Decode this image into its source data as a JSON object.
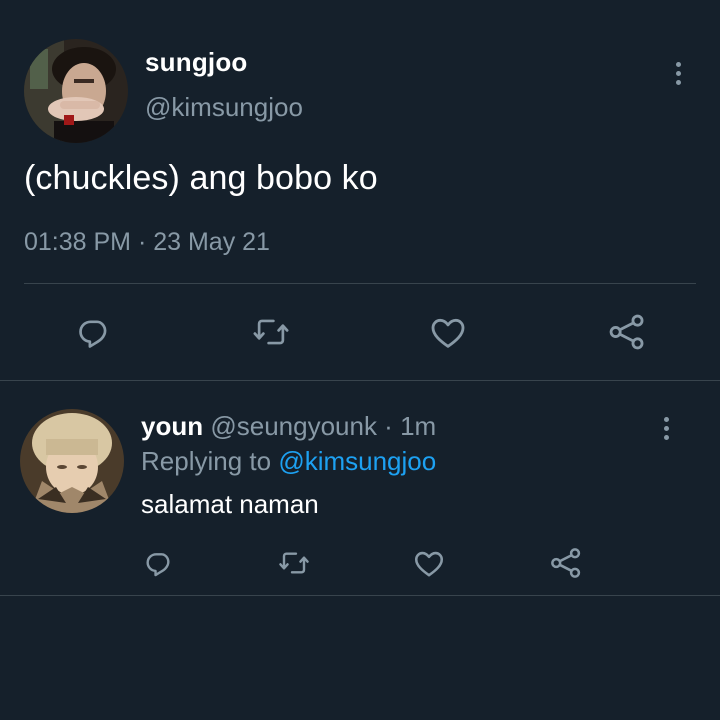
{
  "colors": {
    "background": "#15202b",
    "text_primary": "#ffffff",
    "text_secondary": "#8899a6",
    "divider": "#38444d",
    "link": "#1da1f2"
  },
  "main_tweet": {
    "display_name": "sungjoo",
    "handle": "@kimsungjoo",
    "text": "(chuckles) ang bobo ko",
    "timestamp": "01:38 PM · 23 May 21",
    "icons": [
      "more-vertical-icon",
      "reply-icon",
      "retweet-icon",
      "like-icon",
      "share-icon"
    ]
  },
  "reply_tweet": {
    "display_name": "youn",
    "meta": "@seungyounk · 1m",
    "replying_prefix": "Replying to",
    "replying_mention": "@kimsungjoo",
    "text": "salamat naman",
    "icons": [
      "more-vertical-icon",
      "reply-icon",
      "retweet-icon",
      "like-icon",
      "share-icon"
    ]
  }
}
